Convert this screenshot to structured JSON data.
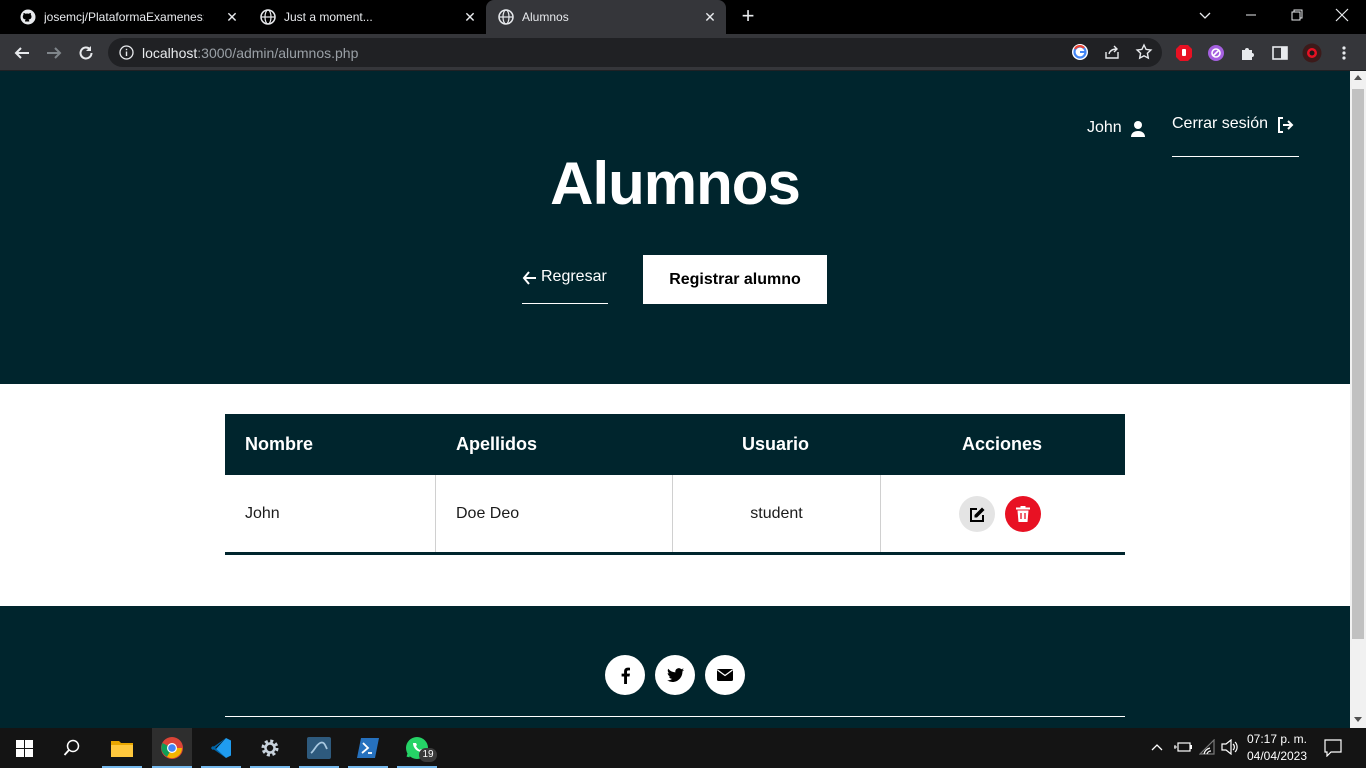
{
  "browser": {
    "tabs": [
      {
        "title": "josemcj/PlataformaExamenes: Pla",
        "icon": "github-icon"
      },
      {
        "title": "Just a moment...",
        "icon": "globe-icon"
      },
      {
        "title": "Alumnos",
        "icon": "globe-icon",
        "active": true
      }
    ],
    "url_host": "localhost",
    "url_path": ":3000/admin/alumnos.php"
  },
  "header": {
    "user_name": "John",
    "logout_label": "Cerrar sesión",
    "title": "Alumnos",
    "back_label": "Regresar",
    "register_label": "Registrar alumno"
  },
  "table": {
    "columns": [
      "Nombre",
      "Apellidos",
      "Usuario",
      "Acciones"
    ],
    "rows": [
      {
        "nombre": "John",
        "apellidos": "Doe Deo",
        "usuario": "student"
      }
    ]
  },
  "footer": {
    "social": [
      "facebook-icon",
      "twitter-icon",
      "email-icon"
    ]
  },
  "taskbar": {
    "time": "07:17 p. m.",
    "date": "04/04/2023",
    "whatsapp_badge": "19"
  },
  "colors": {
    "primary": "#00252d",
    "danger": "#e81123",
    "edit_bg": "#e4e4e4"
  }
}
